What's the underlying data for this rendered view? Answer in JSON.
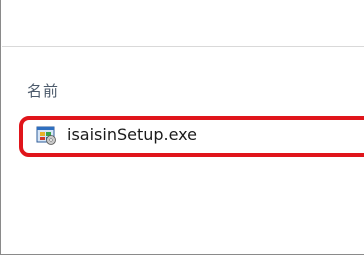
{
  "file_list": {
    "column_header": "名前",
    "items": [
      {
        "name": "isaisinSetup.exe",
        "icon": "installer-exe-icon",
        "highlighted": true
      }
    ]
  },
  "colors": {
    "highlight_border": "#e0151b",
    "header_text": "#4c5a6b",
    "frame_border": "#8a8a8a"
  }
}
